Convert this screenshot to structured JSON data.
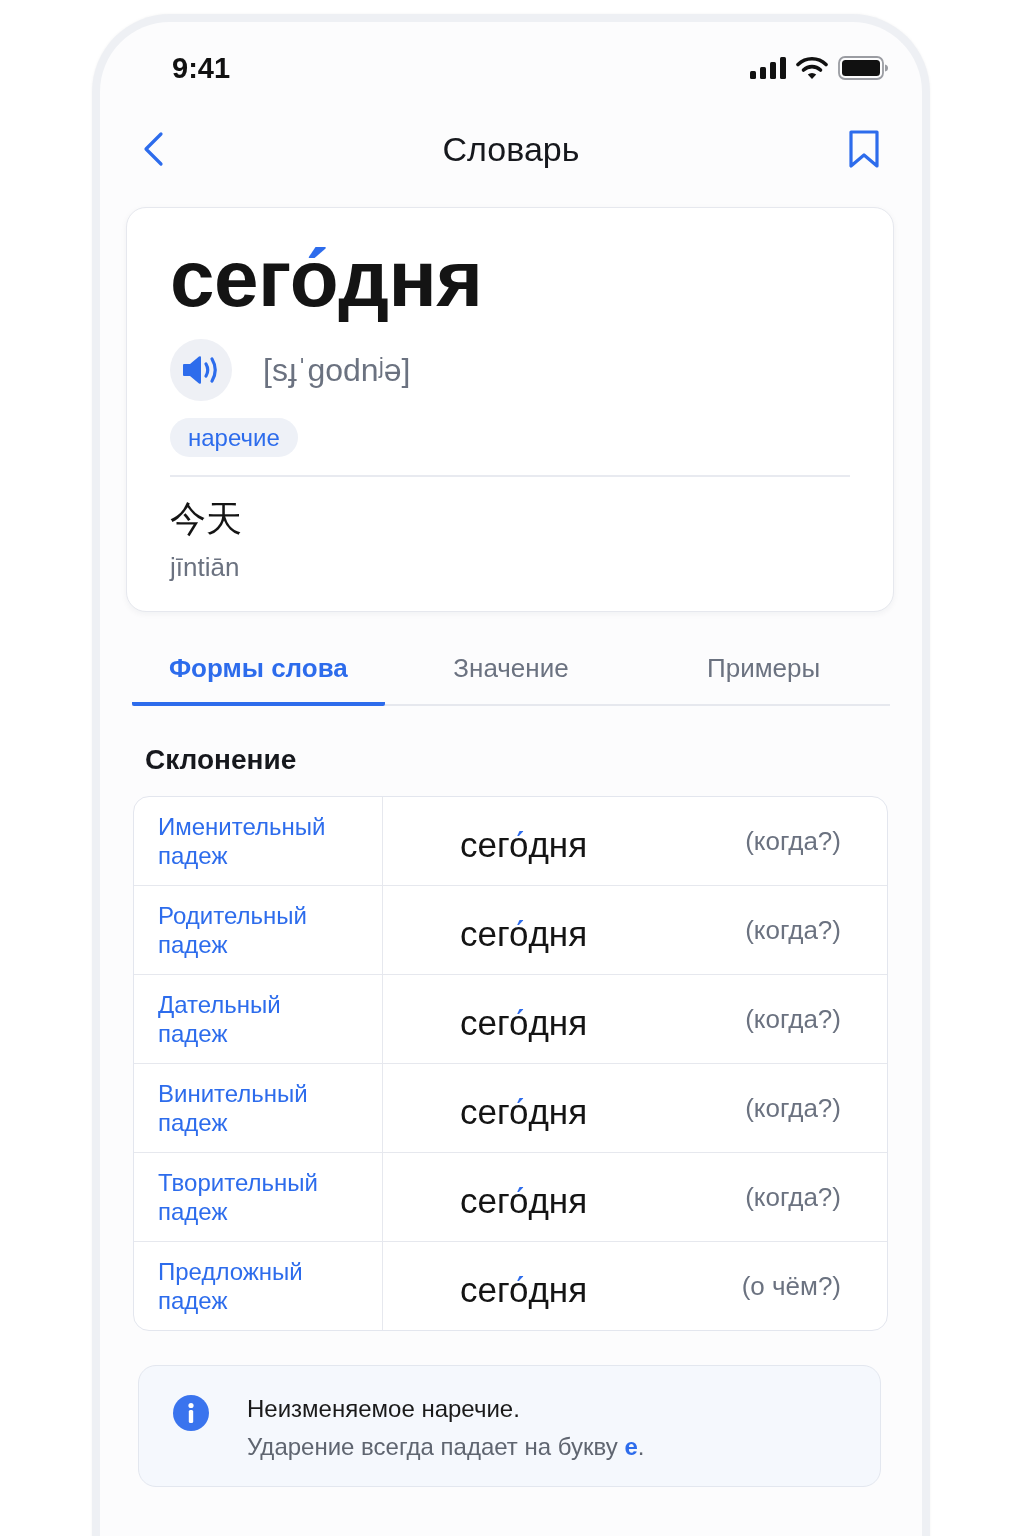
{
  "status_bar": {
    "time": "9:41"
  },
  "nav": {
    "title": "Словарь"
  },
  "entry": {
    "headword": "сего́дня",
    "transcription": "[sɟˈgodnʲə]",
    "part_of_speech": "наречие",
    "translation": "今天",
    "pinyin": "jīntiān"
  },
  "tabs": [
    {
      "label": "Формы слова",
      "selected": true
    },
    {
      "label": "Значение",
      "selected": false
    },
    {
      "label": "Примеры",
      "selected": false
    }
  ],
  "declension": {
    "title": "Склонение",
    "rows": [
      {
        "case": "Именительный падеж",
        "form": "сего́дня",
        "question": "(когда?)"
      },
      {
        "case": "Родительный падеж",
        "form": "сего́дня",
        "question": "(когда?)"
      },
      {
        "case": "Дательный падеж",
        "form": "сего́дня",
        "question": "(когда?)"
      },
      {
        "case": "Винительный падеж",
        "form": "сего́дня",
        "question": "(когда?)"
      },
      {
        "case": "Творительный падеж",
        "form": "сего́дня",
        "question": "(когда?)"
      },
      {
        "case": "Предложный падеж",
        "form": "сего́дня",
        "question": "(о чём?)"
      }
    ]
  },
  "note": {
    "title": "Неизменяемое наречие.",
    "text": "Ударение всегда падает на букву **е**."
  }
}
